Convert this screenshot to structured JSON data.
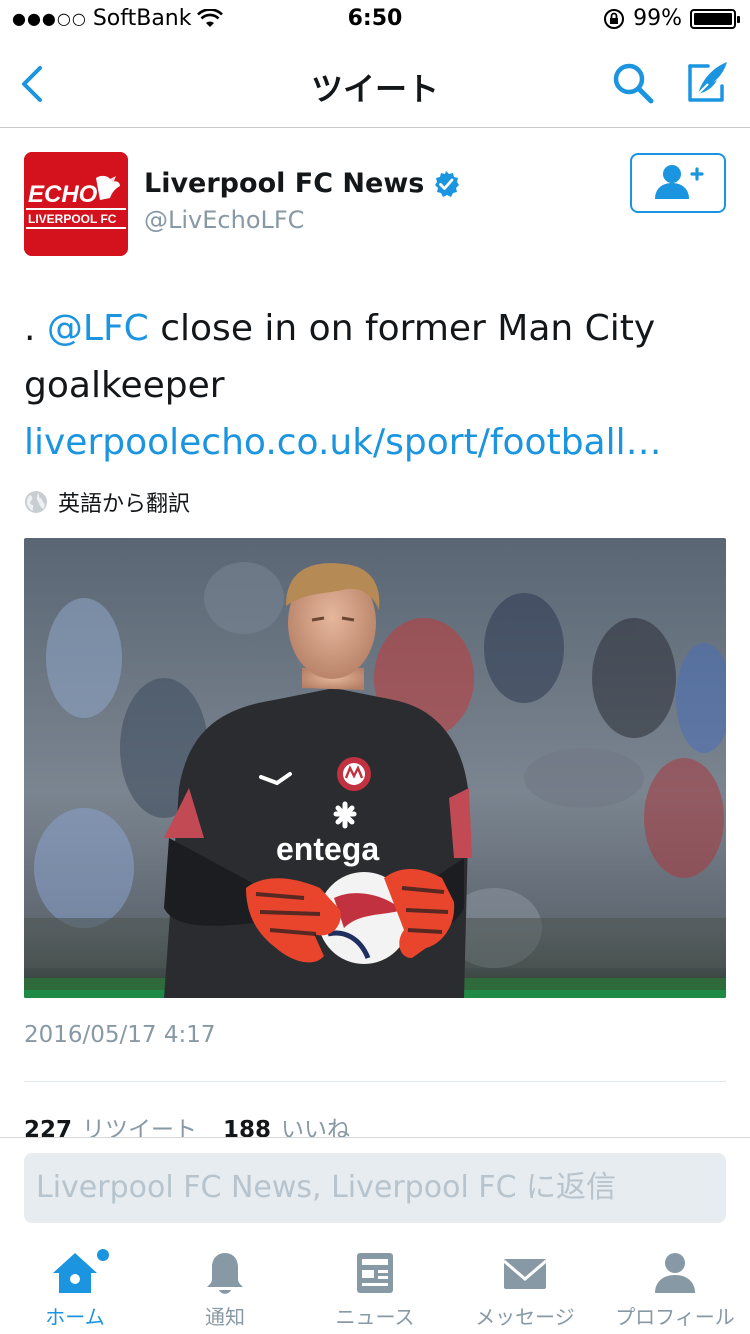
{
  "status_bar": {
    "carrier": "SoftBank",
    "signal_dots": "●●●○○",
    "time": "6:50",
    "battery_percent": "99%",
    "battery_level": 0.99
  },
  "nav": {
    "title": "ツイート"
  },
  "tweet": {
    "user_name": "Liverpool FC News",
    "handle": "@LivEchoLFC",
    "avatar_text_top": "ECHO",
    "avatar_text_bottom": "LIVERPOOL FC",
    "text_prefix": ". ",
    "mention": "@LFC",
    "text_rest": " close in on former Man City goalkeeper",
    "link": "liverpoolecho.co.uk/sport/football…",
    "translate_label": "英語から翻訳",
    "photo_sponsor": "entega",
    "timestamp": "2016/05/17 4:17",
    "retweet_count": "227",
    "retweet_label": "リツイート",
    "like_count": "188",
    "like_label": "いいね"
  },
  "reply": {
    "placeholder": "Liverpool FC News, Liverpool FC に返信"
  },
  "tabs": [
    {
      "label": "ホーム",
      "icon": "home-icon",
      "active": true
    },
    {
      "label": "通知",
      "icon": "bell-icon",
      "active": false
    },
    {
      "label": "ニュース",
      "icon": "news-icon",
      "active": false
    },
    {
      "label": "メッセージ",
      "icon": "envelope-icon",
      "active": false
    },
    {
      "label": "プロフィール",
      "icon": "person-icon",
      "active": false
    }
  ],
  "colors": {
    "accent": "#1b95e0",
    "muted": "#8899a6",
    "avatar_red": "#d4121d"
  }
}
